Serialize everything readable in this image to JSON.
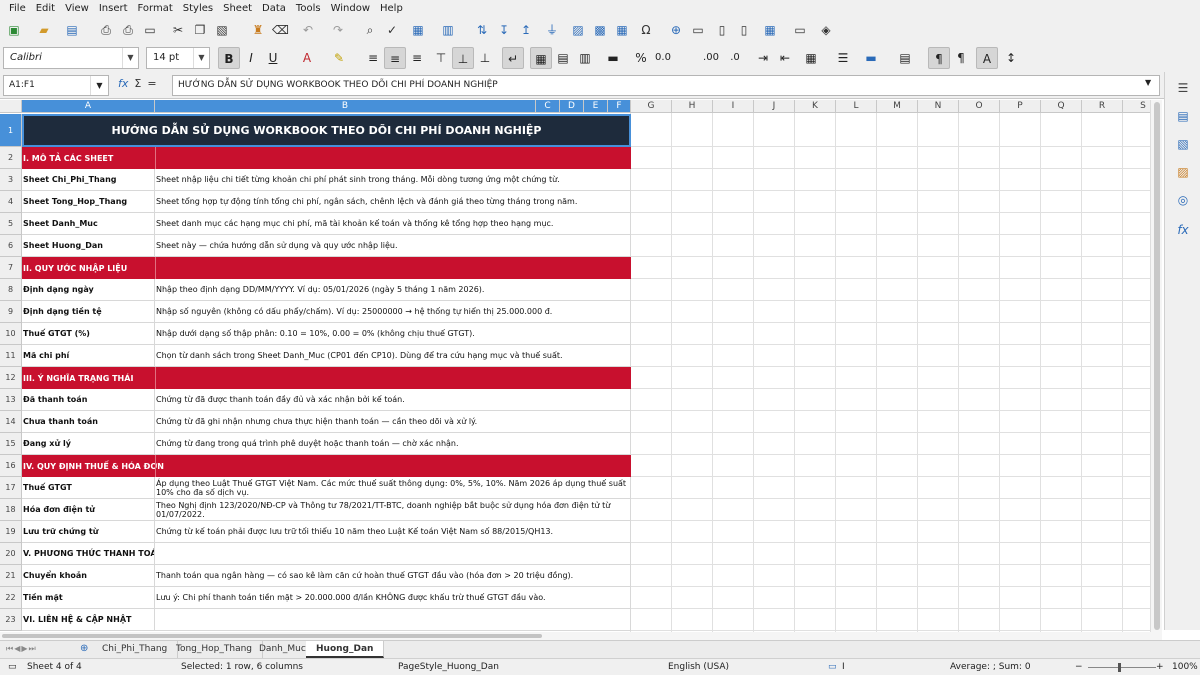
{
  "menu": [
    "File",
    "Edit",
    "View",
    "Insert",
    "Format",
    "Styles",
    "Sheet",
    "Data",
    "Tools",
    "Window",
    "Help"
  ],
  "font": {
    "name": "Calibri",
    "size": "14 pt"
  },
  "name_box": "A1:F1",
  "formula": "HƯỚNG DẪN SỬ DỤNG WORKBOOK THEO DÕI CHI PHÍ DOANH NGHIỆP",
  "columns": [
    "A",
    "B",
    "C",
    "D",
    "E",
    "F",
    "G",
    "H",
    "I",
    "J",
    "K",
    "L",
    "M",
    "N",
    "O",
    "P",
    "Q",
    "R",
    "S"
  ],
  "selected_columns": [
    "A",
    "B",
    "C",
    "D",
    "E",
    "F"
  ],
  "title": "HƯỚNG DẪN SỬ DỤNG WORKBOOK THEO DÕI CHI PHÍ DOANH NGHIỆP",
  "rows": [
    {
      "n": "2",
      "type": "section",
      "a": "I. MÔ TẢ CÁC SHEET",
      "b": ""
    },
    {
      "n": "3",
      "type": "item",
      "a": "Sheet Chi_Phi_Thang",
      "b": "Sheet nhập liệu chi tiết từng khoản chi phí phát sinh trong tháng. Mỗi dòng tương ứng một chứng từ."
    },
    {
      "n": "4",
      "type": "item",
      "a": "Sheet Tong_Hop_Thang",
      "b": "Sheet tổng hợp tự động tính tổng chi phí, ngân sách, chênh lệch và đánh giá theo từng tháng trong năm."
    },
    {
      "n": "5",
      "type": "item",
      "a": "Sheet Danh_Muc",
      "b": "Sheet danh mục các hạng mục chi phí, mã tài khoản kế toán và thống kê tổng hợp theo hạng mục."
    },
    {
      "n": "6",
      "type": "item",
      "a": "Sheet Huong_Dan",
      "b": "Sheet này — chứa hướng dẫn sử dụng và quy ước nhập liệu."
    },
    {
      "n": "7",
      "type": "section",
      "a": "II. QUY ƯỚC NHẬP LIỆU",
      "b": ""
    },
    {
      "n": "8",
      "type": "item",
      "a": "Định dạng ngày",
      "b": "Nhập theo định dạng DD/MM/YYYY. Ví dụ: 05/01/2026 (ngày 5 tháng 1 năm 2026)."
    },
    {
      "n": "9",
      "type": "item",
      "a": "Định dạng tiền tệ",
      "b": "Nhập số nguyên (không có dấu phẩy/chấm). Ví dụ: 25000000 → hệ thống tự hiển thị 25.000.000 đ."
    },
    {
      "n": "10",
      "type": "item",
      "a": "Thuế GTGT (%)",
      "b": "Nhập dưới dạng số thập phân: 0.10 = 10%, 0.00 = 0% (không chịu thuế GTGT)."
    },
    {
      "n": "11",
      "type": "item",
      "a": "Mã chi phí",
      "b": "Chọn từ danh sách trong Sheet Danh_Muc (CP01 đến CP10). Dùng để tra cứu hạng mục và thuế suất."
    },
    {
      "n": "12",
      "type": "section",
      "a": "III. Ý NGHĨA TRẠNG THÁI",
      "b": ""
    },
    {
      "n": "13",
      "type": "item",
      "a": "Đã thanh toán",
      "b": "Chứng từ đã được thanh toán đầy đủ và xác nhận bởi kế toán."
    },
    {
      "n": "14",
      "type": "item",
      "a": "Chưa thanh toán",
      "b": "Chứng từ đã ghi nhận nhưng chưa thực hiện thanh toán — cần theo dõi và xử lý."
    },
    {
      "n": "15",
      "type": "item",
      "a": "Đang xử lý",
      "b": "Chứng từ đang trong quá trình phê duyệt hoặc thanh toán — chờ xác nhận."
    },
    {
      "n": "16",
      "type": "section",
      "a": "IV. QUY ĐỊNH THUẾ & HÓA ĐƠN",
      "b": ""
    },
    {
      "n": "17",
      "type": "item",
      "a": "Thuế GTGT",
      "b": "Áp dụng theo Luật Thuế GTGT Việt Nam. Các mức thuế suất thông dụng: 0%, 5%, 10%. Năm 2026 áp dụng thuế suất 10% cho đa số dịch vụ."
    },
    {
      "n": "18",
      "type": "item",
      "a": "Hóa đơn điện tử",
      "b": "Theo Nghị định 123/2020/NĐ-CP và Thông tư 78/2021/TT-BTC, doanh nghiệp bắt buộc sử dụng hóa đơn điện tử từ 01/07/2022."
    },
    {
      "n": "19",
      "type": "item",
      "a": "Lưu trữ chứng từ",
      "b": "Chứng từ kế toán phải được lưu trữ tối thiểu 10 năm theo Luật Kế toán Việt Nam số 88/2015/QH13."
    },
    {
      "n": "20",
      "type": "item",
      "a": "V. PHƯƠNG THỨC THANH TOÁN",
      "b": ""
    },
    {
      "n": "21",
      "type": "item",
      "a": "Chuyển khoản",
      "b": "Thanh toán qua ngân hàng — có sao kê làm căn cứ hoàn thuế GTGT đầu vào (hóa đơn > 20 triệu đồng)."
    },
    {
      "n": "22",
      "type": "item",
      "a": "Tiền mặt",
      "b": "Lưu ý: Chi phí thanh toán tiền mặt > 20.000.000 đ/lần KHÔNG được khấu trừ thuế GTGT đầu vào."
    },
    {
      "n": "23",
      "type": "item",
      "a": "VI. LIÊN HỆ & CẬP NHẬT",
      "b": ""
    }
  ],
  "tabs": [
    "Chi_Phi_Thang",
    "Tong_Hop_Thang",
    "Danh_Muc",
    "Huong_Dan"
  ],
  "active_tab": "Huong_Dan",
  "status": {
    "sheet": "Sheet 4 of 4",
    "selection": "Selected: 1 row, 6 columns",
    "page_style": "PageStyle_Huong_Dan",
    "language": "English (USA)",
    "sum": "Average: ; Sum: 0",
    "zoom": "100%"
  },
  "colors": {
    "title_bg": "#1e2b3c",
    "section_bg": "#c8102e",
    "selection": "#4790d9"
  }
}
